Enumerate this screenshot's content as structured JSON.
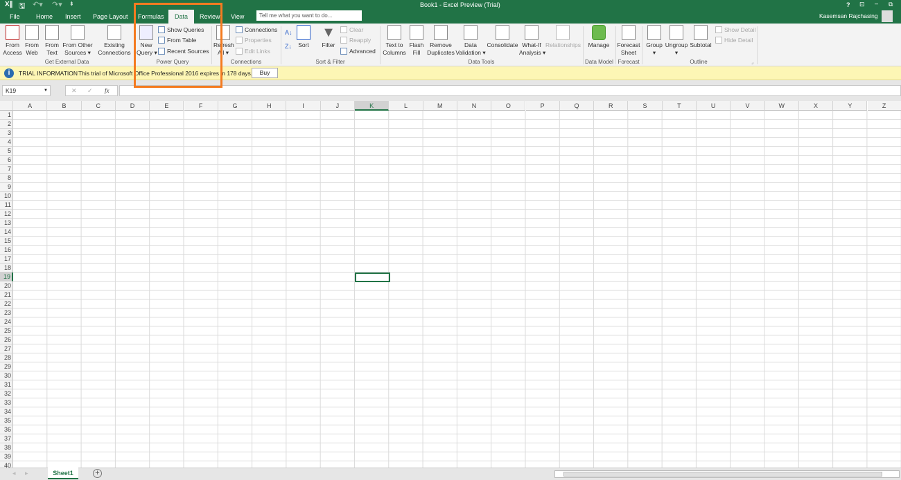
{
  "window": {
    "title": "Book1 - Excel Preview (Trial)",
    "user": "Kasemsan Rajchasing",
    "help": "?"
  },
  "tabs": [
    "File",
    "Home",
    "Insert",
    "Page Layout",
    "Formulas",
    "Data",
    "Review",
    "View"
  ],
  "active_tab": "Data",
  "tell_me": {
    "placeholder": "Tell me what you want to do..."
  },
  "ribbon": {
    "get_external": {
      "label": "Get External Data",
      "from_access": "From\nAccess",
      "from_web": "From\nWeb",
      "from_text": "From\nText",
      "from_other": "From Other\nSources ▾",
      "existing": "Existing\nConnections"
    },
    "power_query": {
      "label": "Power Query",
      "new_query": "New\nQuery ▾",
      "show_queries": "Show Queries",
      "from_table": "From Table",
      "recent_sources": "Recent Sources"
    },
    "connections": {
      "label": "Connections",
      "refresh": "Refresh\nAll ▾",
      "connections": "Connections",
      "properties": "Properties",
      "edit_links": "Edit Links"
    },
    "sort_filter": {
      "label": "Sort & Filter",
      "sort": "Sort",
      "filter": "Filter",
      "clear": "Clear",
      "reapply": "Reapply",
      "advanced": "Advanced"
    },
    "data_tools": {
      "label": "Data Tools",
      "text_to_columns": "Text to\nColumns",
      "flash_fill": "Flash\nFill",
      "remove_duplicates": "Remove\nDuplicates",
      "data_validation": "Data\nValidation ▾",
      "consolidate": "Consolidate",
      "what_if": "What-If\nAnalysis ▾",
      "relationships": "Relationships"
    },
    "data_model": {
      "label": "Data Model",
      "manage": "Manage"
    },
    "forecast": {
      "label": "Forecast",
      "forecast_sheet": "Forecast\nSheet"
    },
    "outline": {
      "label": "Outline",
      "group": "Group\n▾",
      "ungroup": "Ungroup\n▾",
      "subtotal": "Subtotal",
      "show_detail": "Show Detail",
      "hide_detail": "Hide Detail"
    }
  },
  "trial": {
    "title": "TRIAL INFORMATION",
    "message": "This trial of Microsoft Office Professional 2016 expires in 178 days.",
    "buy": "Buy"
  },
  "formula_bar": {
    "name_box": "K19",
    "cancel": "✕",
    "enter": "✓",
    "fx": "fx",
    "value": ""
  },
  "columns": [
    "A",
    "B",
    "C",
    "D",
    "E",
    "F",
    "G",
    "H",
    "I",
    "J",
    "K",
    "L",
    "M",
    "N",
    "O",
    "P",
    "Q",
    "R",
    "S",
    "T",
    "U",
    "V",
    "W",
    "X",
    "Y",
    "Z"
  ],
  "rows": [
    "1",
    "2",
    "3",
    "4",
    "5",
    "6",
    "7",
    "8",
    "9",
    "10",
    "11",
    "12",
    "13",
    "14",
    "15",
    "16",
    "17",
    "18",
    "19",
    "20",
    "21",
    "22",
    "23",
    "24",
    "25",
    "26",
    "27",
    "28",
    "29",
    "30",
    "31",
    "32",
    "33",
    "34",
    "35",
    "36",
    "37",
    "38",
    "39",
    "40"
  ],
  "selected_cell": "K19",
  "sheets": [
    "Sheet1"
  ],
  "colors": {
    "accent": "#217346",
    "highlight": "#f47b20",
    "trial_bg": "#fdf6b5"
  }
}
